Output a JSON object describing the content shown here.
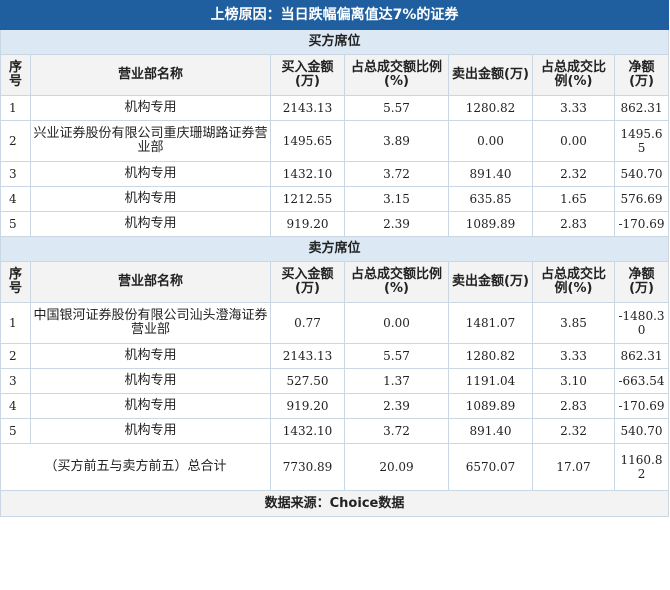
{
  "title": "上榜原因：当日跌幅偏离值达7%的证券",
  "buy_section": "买方席位",
  "sell_section": "卖方席位",
  "headers": {
    "idx": "序号",
    "name": "营业部名称",
    "buy": "买入金额(万)",
    "buy_pct": "占总成交额比例(%)",
    "sell": "卖出金额(万)",
    "sell_pct": "占总成交比例(%)",
    "net": "净额(万)"
  },
  "buy_rows": [
    {
      "idx": "1",
      "name": "机构专用",
      "buy": "2143.13",
      "buy_pct": "5.57",
      "sell": "1280.82",
      "sell_pct": "3.33",
      "net": "862.31"
    },
    {
      "idx": "2",
      "name": "兴业证券股份有限公司重庆珊瑚路证券营业部",
      "buy": "1495.65",
      "buy_pct": "3.89",
      "sell": "0.00",
      "sell_pct": "0.00",
      "net": "1495.65"
    },
    {
      "idx": "3",
      "name": "机构专用",
      "buy": "1432.10",
      "buy_pct": "3.72",
      "sell": "891.40",
      "sell_pct": "2.32",
      "net": "540.70"
    },
    {
      "idx": "4",
      "name": "机构专用",
      "buy": "1212.55",
      "buy_pct": "3.15",
      "sell": "635.85",
      "sell_pct": "1.65",
      "net": "576.69"
    },
    {
      "idx": "5",
      "name": "机构专用",
      "buy": "919.20",
      "buy_pct": "2.39",
      "sell": "1089.89",
      "sell_pct": "2.83",
      "net": "-170.69"
    }
  ],
  "sell_rows": [
    {
      "idx": "1",
      "name": "中国银河证券股份有限公司汕头澄海证券营业部",
      "buy": "0.77",
      "buy_pct": "0.00",
      "sell": "1481.07",
      "sell_pct": "3.85",
      "net": "-1480.30"
    },
    {
      "idx": "2",
      "name": "机构专用",
      "buy": "2143.13",
      "buy_pct": "5.57",
      "sell": "1280.82",
      "sell_pct": "3.33",
      "net": "862.31"
    },
    {
      "idx": "3",
      "name": "机构专用",
      "buy": "527.50",
      "buy_pct": "1.37",
      "sell": "1191.04",
      "sell_pct": "3.10",
      "net": "-663.54"
    },
    {
      "idx": "4",
      "name": "机构专用",
      "buy": "919.20",
      "buy_pct": "2.39",
      "sell": "1089.89",
      "sell_pct": "2.83",
      "net": "-170.69"
    },
    {
      "idx": "5",
      "name": "机构专用",
      "buy": "1432.10",
      "buy_pct": "3.72",
      "sell": "891.40",
      "sell_pct": "2.32",
      "net": "540.70"
    }
  ],
  "total": {
    "label": "（买方前五与卖方前五）总合计",
    "buy": "7730.89",
    "buy_pct": "20.09",
    "sell": "6570.07",
    "sell_pct": "17.07",
    "net": "1160.82"
  },
  "footer": "数据来源：Choice数据",
  "colors": {
    "title_bg": "#1f5f9f",
    "section_bg": "#dce9f5",
    "header_bg": "#f3f3f3",
    "border": "#c9d6e3"
  }
}
